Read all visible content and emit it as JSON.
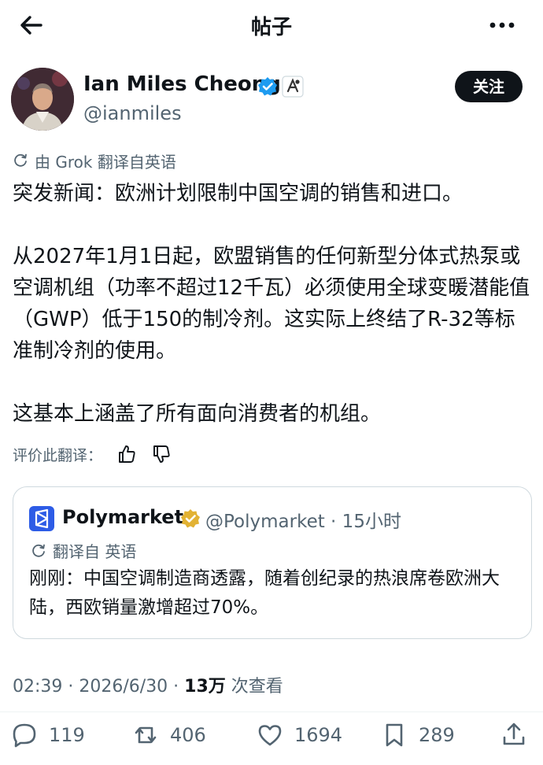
{
  "header": {
    "title": "帖子",
    "back_icon": "back-arrow-icon",
    "more_icon": "more-icon"
  },
  "author": {
    "name": "Ian Miles Cheong",
    "handle": "@ianmiles",
    "follow_label": "关注",
    "verified_color": "#1d9bf0"
  },
  "post": {
    "translated_note": "由 Grok 翻译自英语",
    "text": "突发新闻：欧洲计划限制中国空调的销售和进口。\n\n从2027年1月1日起，欧盟销售的任何新型分体式热泵或空调机组（功率不超过12千瓦）必须使用全球变暖潜能值（GWP）低于150的制冷剂。这实际上终结了R-32等标准制冷剂的使用。\n\n这基本上涵盖了所有面向消费者的机组。",
    "rate_label": "评价此翻译："
  },
  "quote": {
    "name": "Polymarket",
    "meta": "@Polymarket · 15小时",
    "translated_note": "翻译自 英语",
    "text": "刚刚：中国空调制造商透露，随着创纪录的热浪席卷欧洲大陆，西欧销量激增超过70%。",
    "badge_color": "#e2b234",
    "logo_color": "#2d5ce6"
  },
  "stats": {
    "time": "02:39 · 2026/6/30 · ",
    "views": "13万",
    "views_label": " 次查看"
  },
  "actions": {
    "replies": "119",
    "reposts": "406",
    "likes": "1694",
    "bookmarks": "289"
  }
}
